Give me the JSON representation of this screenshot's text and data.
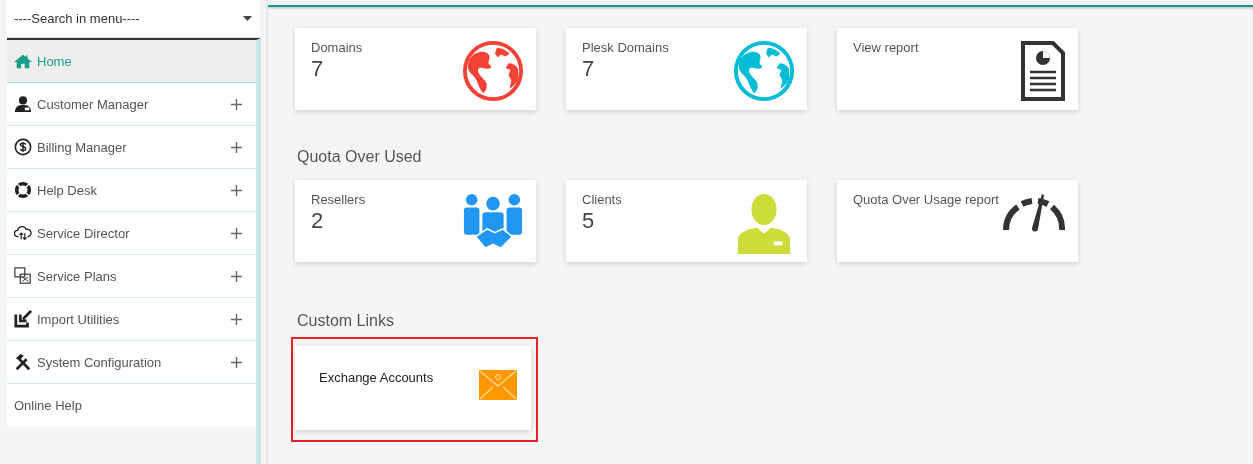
{
  "sidebar": {
    "search": {
      "placeholder": "----Search in menu----"
    },
    "items": [
      {
        "label": "Home",
        "kind": "home",
        "selected": true,
        "expandable": false
      },
      {
        "label": "Customer Manager",
        "kind": "user",
        "selected": false,
        "expandable": true
      },
      {
        "label": "Billing Manager",
        "kind": "dollar",
        "selected": false,
        "expandable": true
      },
      {
        "label": "Help Desk",
        "kind": "lifebuoy",
        "selected": false,
        "expandable": true
      },
      {
        "label": "Service Director",
        "kind": "cloud",
        "selected": false,
        "expandable": true
      },
      {
        "label": "Service Plans",
        "kind": "plans",
        "selected": false,
        "expandable": true
      },
      {
        "label": "Import Utilities",
        "kind": "import",
        "selected": false,
        "expandable": true
      },
      {
        "label": "System Configuration",
        "kind": "tools",
        "selected": false,
        "expandable": true
      },
      {
        "label": "Online Help",
        "kind": "text",
        "selected": false,
        "expandable": false
      }
    ]
  },
  "sections": [
    {
      "cards": [
        {
          "label": "Domains",
          "value": "7",
          "kind": "globe",
          "color": "#f44336"
        },
        {
          "label": "Plesk Domains",
          "value": "7",
          "kind": "globe",
          "color": "#00bcd4"
        },
        {
          "label": "View report",
          "kind": "report",
          "color": "#333333"
        }
      ]
    },
    {
      "title": "Quota Over Used",
      "cards": [
        {
          "label": "Resellers",
          "value": "2",
          "kind": "people",
          "color": "#2196f3"
        },
        {
          "label": "Clients",
          "value": "5",
          "kind": "person",
          "color": "#cddc39"
        },
        {
          "label": "Quota Over Usage report",
          "kind": "gauge",
          "color": "#333333"
        }
      ]
    },
    {
      "title": "Custom Links",
      "cards": [
        {
          "label": "Exchange Accounts",
          "kind": "mail",
          "color": "#ff9800",
          "highlighted": true
        }
      ]
    }
  ]
}
